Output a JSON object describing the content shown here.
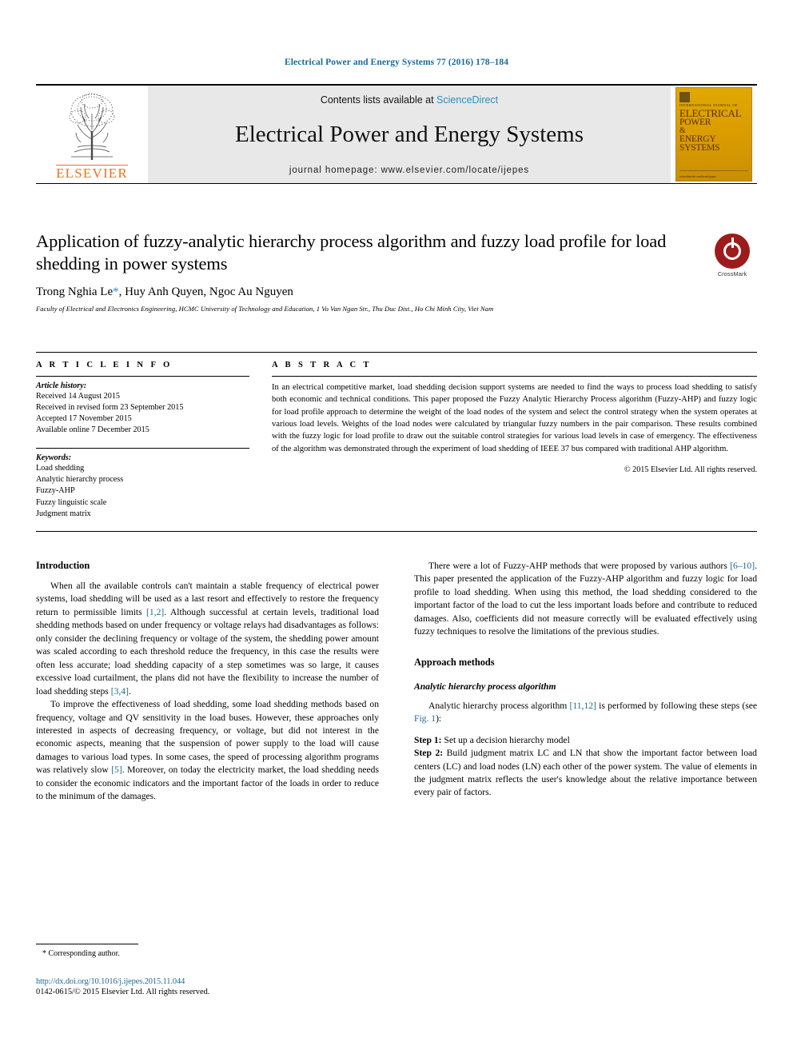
{
  "running_head": "Electrical Power and Energy Systems 77 (2016) 178–184",
  "masthead": {
    "publisher_name": "ELSEVIER",
    "contents_prefix": "Contents lists available at ",
    "contents_link": "ScienceDirect",
    "journal_title": "Electrical Power and Energy Systems",
    "homepage": "journal homepage: www.elsevier.com/locate/ijepes",
    "cover": {
      "sub": "INTERNATIONAL JOURNAL OF",
      "line1": "ELECTRICAL",
      "line2": "POWER",
      "line3": "&",
      "line4": "ENERGY",
      "line5": "SYSTEMS",
      "foot": "www.elsevier.com/locate/ijepes"
    }
  },
  "article": {
    "title": "Application of fuzzy-analytic hierarchy process algorithm and fuzzy load profile for load shedding in power systems",
    "authors": "Trong Nghia Le",
    "authors_rest": ", Huy Anh Quyen, Ngoc Au Nguyen",
    "corresponding_marker": "*",
    "affiliation": "Faculty of Electrical and Electronics Engineering, HCMC University of Technology and Education, 1 Vo Van Ngan Str., Thu Duc Dist., Ho Chi Minh City, Viet Nam",
    "crossmark_label": "CrossMark"
  },
  "info": {
    "heading": "A R T I C L E    I N F O",
    "history_label": "Article history:",
    "history": [
      "Received 14 August 2015",
      "Received in revised form 23 September 2015",
      "Accepted 17 November 2015",
      "Available online 7 December 2015"
    ],
    "keywords_label": "Keywords:",
    "keywords": [
      "Load shedding",
      "Analytic hierarchy process",
      "Fuzzy-AHP",
      "Fuzzy linguistic scale",
      "Judgment matrix"
    ]
  },
  "abstract": {
    "heading": "A B S T R A C T",
    "text": "In an electrical competitive market, load shedding decision support systems are needed to find the ways to process load shedding to satisfy both economic and technical conditions. This paper proposed the Fuzzy Analytic Hierarchy Process algorithm (Fuzzy-AHP) and fuzzy logic for load profile approach to determine the weight of the load nodes of the system and select the control strategy when the system operates at various load levels. Weights of the load nodes were calculated by triangular fuzzy numbers in the pair comparison. These results combined with the fuzzy logic for load profile to draw out the suitable control strategies for various load levels in case of emergency. The effectiveness of the algorithm was demonstrated through the experiment of load shedding of IEEE 37 bus compared with traditional AHP algorithm.",
    "copyright": "© 2015 Elsevier Ltd. All rights reserved."
  },
  "body": {
    "intro_heading": "Introduction",
    "intro_p1_a": "When all the available controls can't maintain a stable frequency of electrical power systems, load shedding will be used as a last resort and effectively to restore the frequency return to permissible limits ",
    "intro_p1_cite1": "[1,2]",
    "intro_p1_b": ". Although successful at certain levels, traditional load shedding methods based on under frequency or voltage relays had disadvantages as follows: only consider the declining frequency or voltage of the system, the shedding power amount was scaled according to each threshold reduce the frequency, in this case the results were often less accurate; load shedding capacity of a step sometimes was so large, it causes excessive load curtailment, the plans did not have the flexibility to increase the number of load shedding steps ",
    "intro_p1_cite2": "[3,4]",
    "intro_p1_c": ".",
    "intro_p2_a": "To improve the effectiveness of load shedding, some load shedding methods based on frequency, voltage and QV sensitivity in the load buses. However, these approaches only interested in aspects of decreasing frequency, or voltage, but did not interest in the economic aspects, meaning that the suspension of power supply to the load will cause damages to various load types. In some cases, the speed of processing algorithm programs was relatively slow ",
    "intro_p2_cite": "[5]",
    "intro_p2_b": ". Moreover, on today the electricity market, the load shedding needs to consider the economic indicators and the important factor of the loads in order to reduce to the minimum of the damages.",
    "right_p1_a": "There were a lot of Fuzzy-AHP methods that were proposed by various authors ",
    "right_p1_cite": "[6–10]",
    "right_p1_b": ". This paper presented the application of the Fuzzy-AHP algorithm and fuzzy logic for load profile to load shedding. When using this method, the load shedding considered to the important factor of the load to cut the less important loads before and contribute to reduced damages. Also, coefficients did not measure correctly will be evaluated effectively using fuzzy techniques to resolve the limitations of the previous studies.",
    "approach_heading": "Approach methods",
    "ahp_subheading": "Analytic hierarchy process algorithm",
    "ahp_p_a": "Analytic hierarchy process algorithm ",
    "ahp_p_cite": "[11,12]",
    "ahp_p_b": " is performed by following these steps (see ",
    "ahp_p_figref": "Fig. 1",
    "ahp_p_c": "):",
    "step1_label": "Step 1:",
    "step1_text": " Set up a decision hierarchy model",
    "step2_label": "Step 2:",
    "step2_text": " Build judgment matrix LC and LN that show the important factor between load centers (LC) and load nodes (LN) each other of the power system. The value of elements in the judgment matrix reflects the user's knowledge about the relative importance between every pair of factors."
  },
  "footer": {
    "corresponding": "* Corresponding author.",
    "doi": "http://dx.doi.org/10.1016/j.ijepes.2015.11.044",
    "issn": "0142-0615/© 2015 Elsevier Ltd. All rights reserved."
  },
  "colors": {
    "link": "#1b6a99",
    "sciencedirect": "#2b8cc4",
    "elsevier_orange": "#f37021",
    "crossmark_red": "#9c1c1c"
  }
}
